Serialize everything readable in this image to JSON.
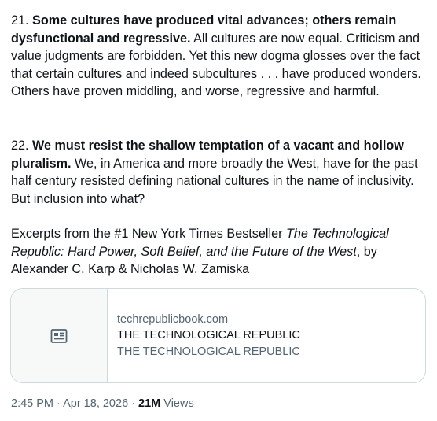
{
  "tweet": {
    "p1": {
      "num": "21. ",
      "bold": "Some cultures have produced vital advances; others remain dysfunctional and regressive.",
      "rest": " All cultures are now equal. Criticism and value judgments are forbidden. Yet this new dogma glosses over the fact that certain cultures and indeed subcultures . . . have produced wonders. Others have proven middling, and worse, regressive and harmful."
    },
    "p2": {
      "num": "22. ",
      "bold": "We must resist the shallow temptation of a vacant and hollow pluralism.",
      "rest": " We, in America and more broadly the West, have for the past half century resisted defining national cultures in the name of inclusivity. But inclusion into what?"
    },
    "p3": {
      "pre": "Excerpts from the #1 New York Times Bestseller ",
      "italic": "The Technological Republic: Hard Power, Soft Belief, and the Future of the West",
      "post": ", by Alexander C. Karp & Nicholas W. Zamiska"
    }
  },
  "card": {
    "domain": "techrepublicbook.com",
    "title": "THE TECHNOLOGICAL REPUBLIC",
    "description": "THE TECHNOLOGICAL REPUBLIC",
    "icon": "article-icon"
  },
  "meta": {
    "time": "2:45 PM",
    "separator": " · ",
    "date": "Apr 18, 2026",
    "views_count": "21M",
    "views_label": " Views"
  }
}
